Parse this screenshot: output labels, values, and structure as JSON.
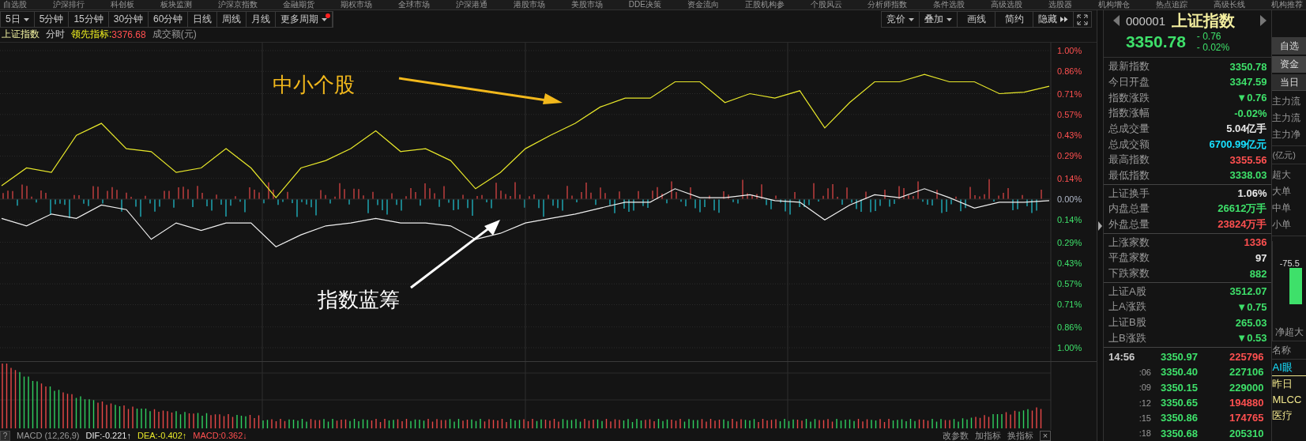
{
  "top_menu": [
    "自选股",
    "沪深排行",
    "科创板",
    "板块监测",
    "沪深京指数",
    "金融期货",
    "期权市场",
    "全球市场",
    "沪深港通",
    "港股市场",
    "美股市场",
    "DDE决策",
    "资金流向",
    "正股机构参",
    "个股风云",
    "分析师指数",
    "条件选股",
    "高级选股",
    "选股器",
    "机构增仓",
    "热点追踪",
    "高级长线",
    "机构推荐"
  ],
  "toolbar": {
    "periods": [
      {
        "label": "5日",
        "dropdown": true,
        "badge": false
      },
      {
        "label": "5分钟",
        "dropdown": false,
        "badge": false
      },
      {
        "label": "15分钟",
        "dropdown": false,
        "badge": false
      },
      {
        "label": "30分钟",
        "dropdown": false,
        "badge": false
      },
      {
        "label": "60分钟",
        "dropdown": false,
        "badge": false
      },
      {
        "label": "日线",
        "dropdown": false,
        "badge": false
      },
      {
        "label": "周线",
        "dropdown": false,
        "badge": false
      },
      {
        "label": "月线",
        "dropdown": false,
        "badge": false
      },
      {
        "label": "更多周期",
        "dropdown": true,
        "badge": true
      }
    ],
    "tools": [
      {
        "label": "竞价",
        "kind": "dropdown"
      },
      {
        "label": "叠加",
        "kind": "dropdown"
      },
      {
        "label": "画线",
        "kind": "plain"
      },
      {
        "label": "简约",
        "kind": "plain"
      },
      {
        "label": "隐藏",
        "kind": "collapse"
      },
      {
        "kind": "fullscreen"
      }
    ]
  },
  "info_bar": {
    "name": "上证指数",
    "mode": "分时",
    "indicator_label": "领先指标:",
    "indicator_value": "3376.68",
    "volume_label": "成交额(元)"
  },
  "main_chart": {
    "chart_data": {
      "type": "line",
      "grid": true,
      "series": [
        {
          "name": "中小个股",
          "color": "#e8e82a",
          "values": [
            0.09,
            0.21,
            0.18,
            0.43,
            0.51,
            0.34,
            0.32,
            0.18,
            0.21,
            0.34,
            0.21,
            0.01,
            0.21,
            0.26,
            0.34,
            0.46,
            0.32,
            0.34,
            0.26,
            0.07,
            0.18,
            0.34,
            0.43,
            0.51,
            0.62,
            0.68,
            0.68,
            0.79,
            0.79,
            0.65,
            0.71,
            0.68,
            0.73,
            0.48,
            0.65,
            0.79,
            0.79,
            0.84,
            0.79,
            0.79,
            0.71,
            0.72,
            0.76
          ]
        },
        {
          "name": "指数蓝筹",
          "color": "#f0f0f0",
          "values": [
            -0.13,
            -0.18,
            -0.1,
            -0.13,
            -0.04,
            -0.07,
            -0.27,
            -0.16,
            -0.21,
            -0.16,
            -0.16,
            -0.32,
            -0.24,
            -0.18,
            -0.16,
            -0.13,
            -0.16,
            -0.16,
            -0.18,
            -0.27,
            -0.23,
            -0.16,
            -0.13,
            -0.1,
            -0.06,
            -0.02,
            -0.02,
            0.07,
            0.01,
            0.01,
            0.03,
            -0.01,
            -0.02,
            -0.14,
            -0.04,
            0.03,
            0.01,
            0.07,
            0.01,
            -0.06,
            -0.02,
            -0.02,
            -0.01
          ]
        }
      ],
      "ylim": [
        -1,
        1
      ],
      "yticks": [
        {
          "value": 1,
          "label": "1.00%"
        },
        {
          "value": 0.86,
          "label": "0.86%"
        },
        {
          "value": 0.71,
          "label": "0.71%"
        },
        {
          "value": 0.57,
          "label": "0.57%"
        },
        {
          "value": 0.43,
          "label": "0.43%"
        },
        {
          "value": 0.29,
          "label": "0.29%"
        },
        {
          "value": 0.14,
          "label": "0.14%"
        },
        {
          "value": 0,
          "label": "0.00%"
        },
        {
          "value": -0.14,
          "label": "0.14%"
        },
        {
          "value": -0.29,
          "label": "0.29%"
        },
        {
          "value": -0.43,
          "label": "0.43%"
        },
        {
          "value": -0.57,
          "label": "0.57%"
        },
        {
          "value": -0.71,
          "label": "0.71%"
        },
        {
          "value": -0.86,
          "label": "0.86%"
        },
        {
          "value": -1,
          "label": "1.00%"
        }
      ]
    }
  },
  "macd": {
    "help": "?",
    "name": "MACD (12,26,9)",
    "values": [
      {
        "text": "DIF:-0.221↑",
        "color": "#e8e8e8"
      },
      {
        "text": "DEA:-0.402↑",
        "color": "#e8e82a"
      },
      {
        "text": "MACD:0.362↓",
        "color": "#ff5050"
      }
    ],
    "actions": [
      "改参数",
      "加指标",
      "换指标"
    ],
    "close": "×"
  },
  "quote_header": {
    "code": "000001",
    "name": "上证指数",
    "price": "3350.78",
    "change": "- 0.76",
    "change_pct": "- 0.02%",
    "watch_button": "自选"
  },
  "stats": [
    [
      {
        "label": "最新指数",
        "value": "3350.78",
        "color": "#3ee06a"
      },
      {
        "label": "今日开盘",
        "value": "3347.59",
        "color": "#3ee06a"
      },
      {
        "label": "指数涨跌",
        "value": "▼0.76",
        "color": "#3ee06a"
      },
      {
        "label": "指数涨幅",
        "value": "-0.02%",
        "color": "#3ee06a"
      },
      {
        "label": "总成交量",
        "value": "5.04亿手",
        "color": "#e8e8e8"
      },
      {
        "label": "总成交额",
        "value": "6700.99亿元",
        "color": "#18e0ff"
      },
      {
        "label": "最高指数",
        "value": "3355.56",
        "color": "#ff5050"
      },
      {
        "label": "最低指数",
        "value": "3338.03",
        "color": "#3ee06a"
      }
    ],
    [
      {
        "label": "上证换手",
        "value": "1.06%",
        "color": "#e8e8e8"
      },
      {
        "label": "内盘总量",
        "value": "26612万手",
        "color": "#3ee06a"
      },
      {
        "label": "外盘总量",
        "value": "23824万手",
        "color": "#ff5050"
      }
    ],
    [
      {
        "label": "上涨家数",
        "value": "1336",
        "color": "#ff5050"
      },
      {
        "label": "平盘家数",
        "value": "97",
        "color": "#e8e8e8"
      },
      {
        "label": "下跌家数",
        "value": "882",
        "color": "#3ee06a"
      }
    ],
    [
      {
        "label": "上证A股",
        "value": "3512.07",
        "color": "#3ee06a"
      },
      {
        "label": "上A涨跌",
        "value": "▼0.75",
        "color": "#3ee06a"
      },
      {
        "label": "上证B股",
        "value": "265.03",
        "color": "#3ee06a"
      },
      {
        "label": "上B涨跌",
        "value": "▼0.53",
        "color": "#3ee06a"
      }
    ]
  ],
  "ticks": [
    {
      "time": "14:56",
      "price": {
        "text": "3350.97",
        "color": "#3ee06a"
      },
      "volume": {
        "text": "225796",
        "color": "#ff5050"
      }
    },
    {
      "time": ":06",
      "price": {
        "text": "3350.40",
        "color": "#3ee06a"
      },
      "volume": {
        "text": "227106",
        "color": "#3ee06a"
      }
    },
    {
      "time": ":09",
      "price": {
        "text": "3350.15",
        "color": "#3ee06a"
      },
      "volume": {
        "text": "229000",
        "color": "#3ee06a"
      }
    },
    {
      "time": ":12",
      "price": {
        "text": "3350.65",
        "color": "#3ee06a"
      },
      "volume": {
        "text": "194880",
        "color": "#ff5050"
      }
    },
    {
      "time": ":15",
      "price": {
        "text": "3350.86",
        "color": "#3ee06a"
      },
      "volume": {
        "text": "174765",
        "color": "#ff5050"
      }
    },
    {
      "time": ":18",
      "price": {
        "text": "3350.68",
        "color": "#3ee06a"
      },
      "volume": {
        "text": "205310",
        "color": "#3ee06a"
      }
    }
  ],
  "side": {
    "tabs": [
      {
        "label": "资金",
        "selected": true
      },
      {
        "label": "当日",
        "selected": false
      }
    ],
    "flows": [
      "主力流",
      "主力流",
      "主力净"
    ],
    "unit": "(亿元)",
    "sizes": [
      "超大",
      "大单",
      "中单",
      "小单"
    ],
    "bar_value": "-75.5",
    "bar_label": "净超大",
    "list_header": "名称",
    "list": [
      {
        "text": "AI眼",
        "selected": true
      },
      {
        "text": "昨日",
        "selected": false
      },
      {
        "text": "MLCC",
        "selected": false
      },
      {
        "text": "医疗",
        "selected": false
      }
    ]
  }
}
